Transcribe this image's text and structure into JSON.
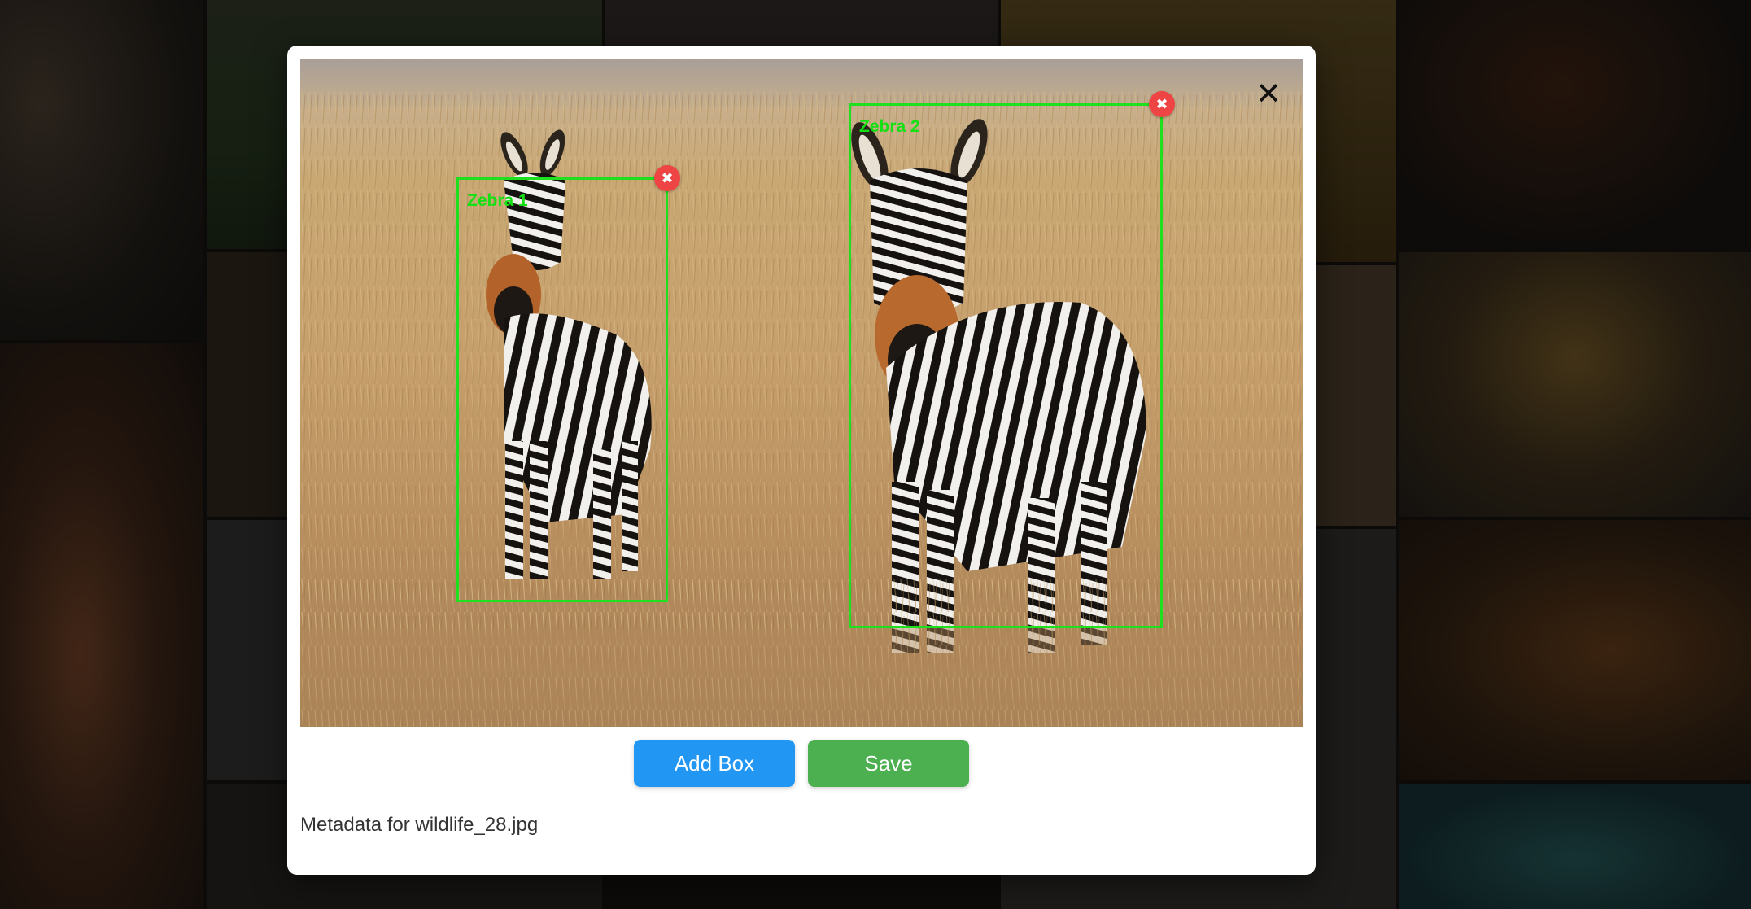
{
  "modal": {
    "close_glyph": "✕",
    "image_name": "wildlife_28.jpg",
    "metadata_text": "Metadata for wildlife_28.jpg",
    "boxes": [
      {
        "label": "Zebra 1",
        "delete_glyph": "✖"
      },
      {
        "label": "Zebra 2",
        "delete_glyph": "✖"
      }
    ],
    "buttons": {
      "add_box": "Add Box",
      "save": "Save"
    }
  },
  "colors": {
    "add_button": "#2196f3",
    "save_button": "#4caf50",
    "box_stroke": "#1ee01e",
    "delete_badge": "#ef4444"
  },
  "background_gallery": [
    "fox-photo",
    "leopard-photo",
    "lion-photo",
    "turtle-photo",
    "zebra-photo",
    "forest-photo"
  ]
}
